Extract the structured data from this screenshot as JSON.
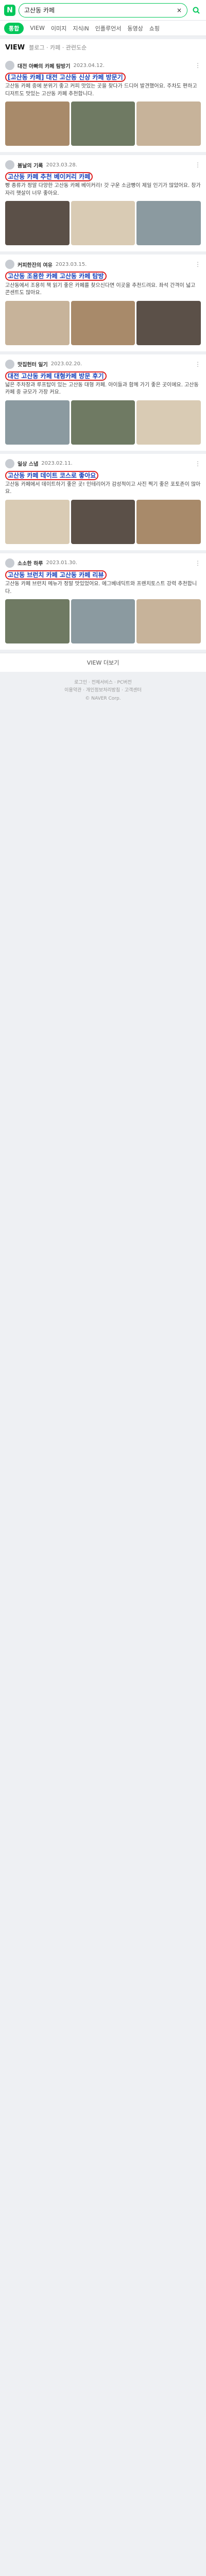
{
  "header": {
    "logo": "N",
    "query": "고산동 카페"
  },
  "tabs": [
    "통합",
    "VIEW",
    "이미지",
    "지식iN",
    "인플루언서",
    "동영상",
    "쇼핑"
  ],
  "section": {
    "title": "VIEW",
    "sub": "블로그 · 카페 · 관련도순"
  },
  "posts": [
    {
      "author": "대전 아빠의 카페 탐방기",
      "date": "2023.04.12.",
      "title": "[고산동 카페] 대전 고산동 신상 카페 방문기",
      "body": "고산동 카페 중에 분위기 좋고 커피 맛있는 곳을 찾다가 드디어 발견했어요. 주차도 편하고 디저트도 맛있는 고산동 카페 추천합니다."
    },
    {
      "author": "봄날의 기록",
      "date": "2023.03.28.",
      "title": "고산동 카페 추천 베이커리 카페",
      "body": "빵 종류가 정말 다양한 고산동 카페 베이커리! 갓 구운 소금빵이 제일 인기가 많았어요. 창가 자리 햇살이 너무 좋아요."
    },
    {
      "author": "커피한잔의 여유",
      "date": "2023.03.15.",
      "title": "고산동 조용한 카페 고산동 카페 탐방",
      "body": "고산동에서 조용히 책 읽기 좋은 카페를 찾으신다면 이곳을 추천드려요. 좌석 간격이 넓고 콘센트도 많아요."
    },
    {
      "author": "맛집헌터 일기",
      "date": "2023.02.20.",
      "title": "대전 고산동 카페 대형카페 방문 후기",
      "body": "넓은 주차장과 루프탑이 있는 고산동 대형 카페. 아이들과 함께 가기 좋은 곳이에요. 고산동 카페 중 규모가 가장 커요."
    },
    {
      "author": "일상 스냅",
      "date": "2023.02.11.",
      "title": "고산동 카페 데이트 코스로 좋아요",
      "body": "고산동 카페에서 데이트하기 좋은 곳! 인테리어가 감성적이고 사진 찍기 좋은 포토존이 많아요."
    },
    {
      "author": "소소한 하루",
      "date": "2023.01.30.",
      "title": "고산동 브런치 카페 고산동 카페 리뷰",
      "body": "고산동 카페 브런치 메뉴가 정말 맛있었어요. 에그베네딕트와 프렌치토스트 강력 추천합니다."
    }
  ],
  "more_label": "VIEW 더보기",
  "footer": {
    "line1": "로그인 · 전체서비스 · PC버전",
    "line2": "이용약관 · 개인정보처리방침 · 고객센터",
    "line3": "© NAVER Corp."
  }
}
